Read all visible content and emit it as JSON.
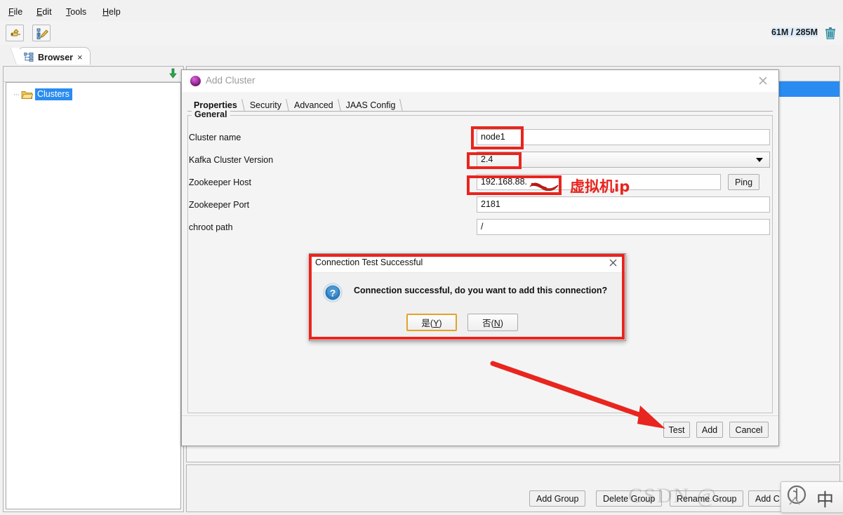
{
  "app": {
    "menu": [
      {
        "label": "File",
        "mnemonic": "F"
      },
      {
        "label": "Edit",
        "mnemonic": "E"
      },
      {
        "label": "Tools",
        "mnemonic": "T"
      },
      {
        "label": "Help",
        "mnemonic": "H"
      }
    ],
    "toolbar": {
      "buttons": [
        {
          "name": "add-connection-icon"
        },
        {
          "name": "edit-tree-icon"
        }
      ],
      "memory": "61M / 285M",
      "trash_icon": "trash-icon"
    },
    "tabs": [
      {
        "label": "Browser",
        "icon": "tree-icon",
        "close": "×"
      }
    ]
  },
  "sidebar": {
    "collapse_icon": "green-down-arrow-icon",
    "tree": [
      {
        "label": "Clusters",
        "icon": "folder-icon",
        "selected": true
      }
    ]
  },
  "main_panel": {
    "group_buttons": [
      {
        "label": "Add Group"
      },
      {
        "label": "Delete Group"
      },
      {
        "label": "Rename Group"
      },
      {
        "label": "Add C"
      }
    ]
  },
  "dialog": {
    "title": "Add Cluster",
    "icon": "cluster-icon",
    "close_icon": "close-icon",
    "tabs": [
      {
        "label": "Properties",
        "active": true
      },
      {
        "label": "Security",
        "active": false
      },
      {
        "label": "Advanced",
        "active": false
      },
      {
        "label": "JAAS Config",
        "active": false
      }
    ],
    "group_legend": "General",
    "fields": [
      {
        "label": "Cluster name",
        "value": "node1",
        "type": "text",
        "highlighted": true
      },
      {
        "label": "Kafka Cluster Version",
        "value": "2.4",
        "type": "combo",
        "highlighted": true
      },
      {
        "label": "Zookeeper Host",
        "value": "192.168.88.",
        "type": "text",
        "highlighted": true,
        "redacted": true,
        "side_button": "Ping"
      },
      {
        "label": "Zookeeper Port",
        "value": "2181",
        "type": "text",
        "highlighted": false
      },
      {
        "label": "chroot path",
        "value": "/",
        "type": "text",
        "highlighted": false
      }
    ],
    "buttons": [
      {
        "label": "Test"
      },
      {
        "label": "Add"
      },
      {
        "label": "Cancel"
      }
    ]
  },
  "confirm_dialog": {
    "title": "Connection Test Successful",
    "close_icon": "close-icon",
    "icon": "question-icon",
    "message": "Connection successful, do you want to add this connection?",
    "buttons": [
      {
        "label": "是(Y)",
        "mnemonic": "Y",
        "focused": true
      },
      {
        "label": "否(N)",
        "mnemonic": "N",
        "focused": false
      }
    ]
  },
  "annotations": {
    "ip_note": "虚拟机ip",
    "color": "#e8251e",
    "arrow_target": "Test",
    "boxes": [
      "cluster-name-field",
      "kafka-version-field",
      "zookeeper-host-field",
      "confirm-dialog"
    ]
  },
  "overlays": {
    "watermark": "CSDN @…",
    "ime_char": "中",
    "ime_logo": "ime-logo-icon"
  },
  "colors": {
    "selection_blue": "#2a8cf0",
    "annotation_red": "#e8251e",
    "focus_gold": "#e2a32b"
  }
}
